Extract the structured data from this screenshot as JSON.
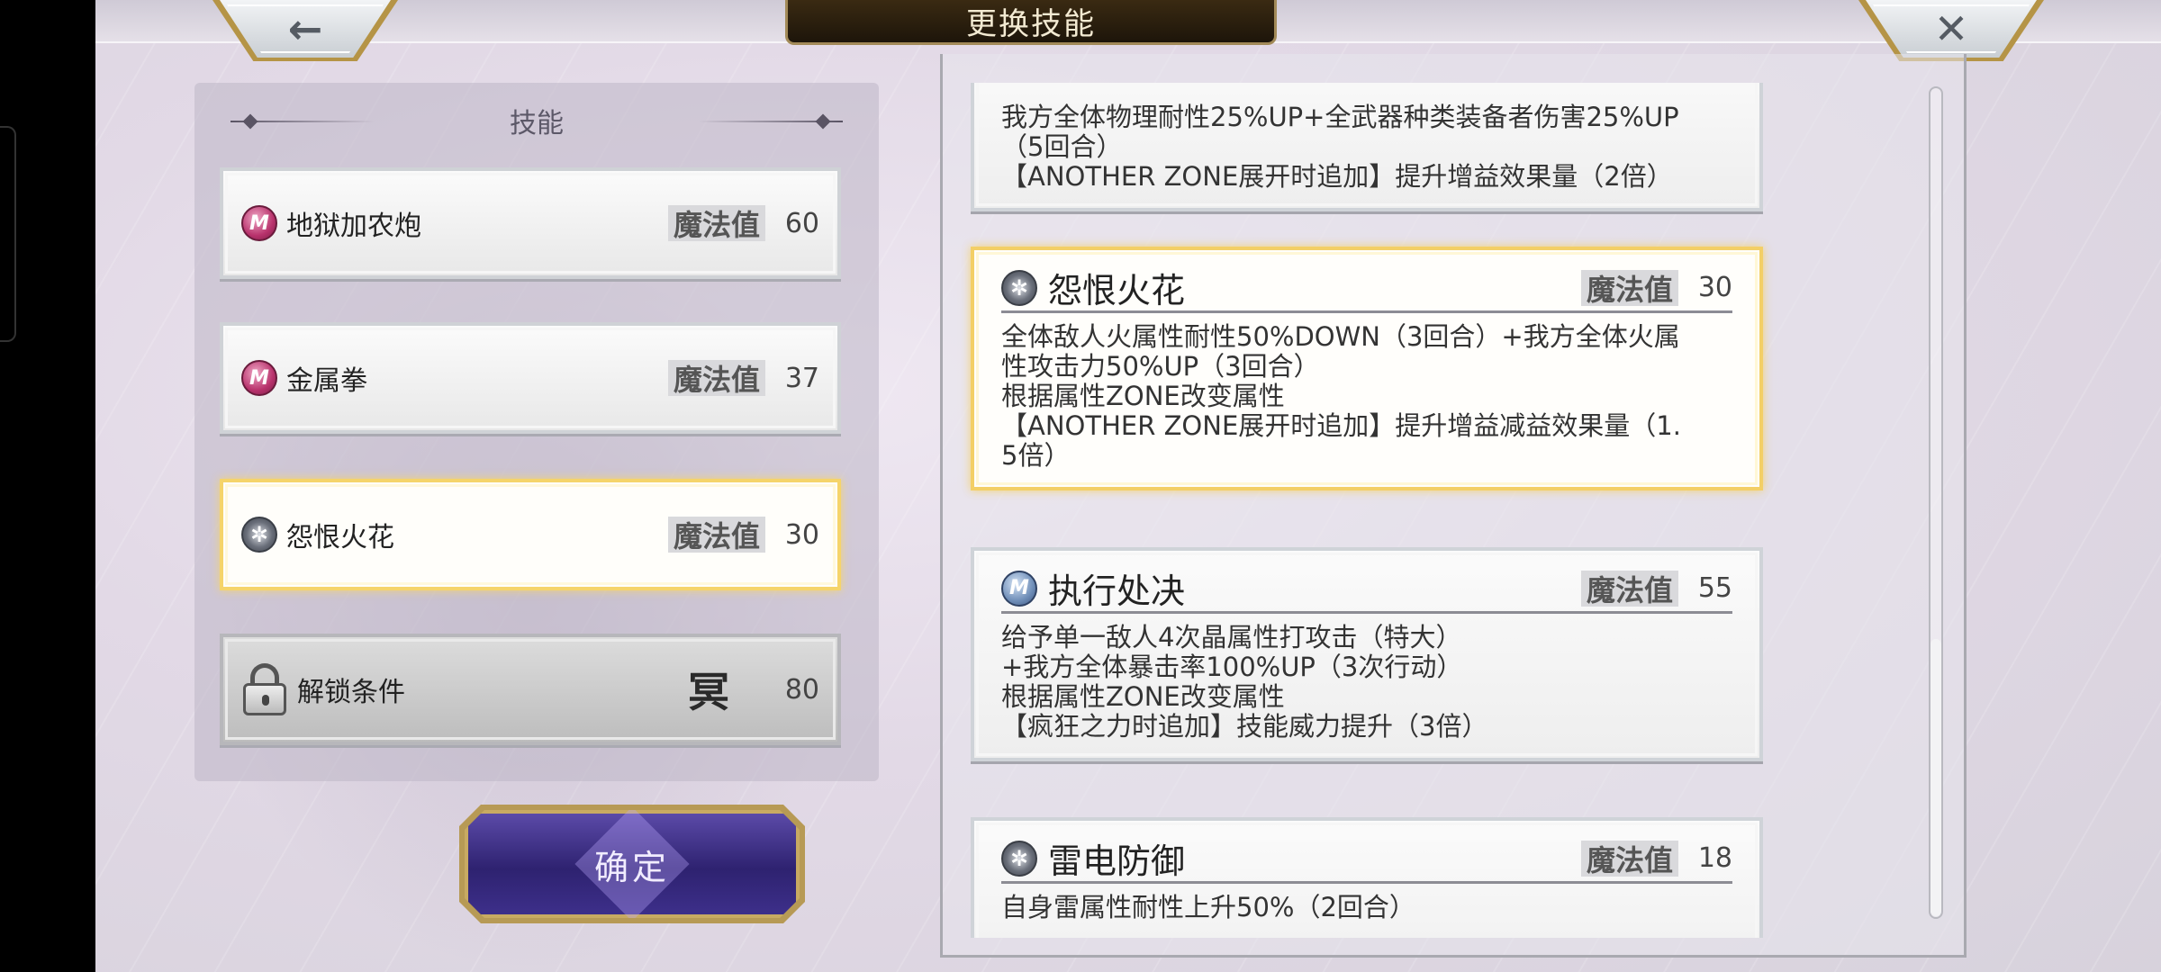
{
  "title": "更换技能",
  "nav": {
    "back_icon": "←",
    "close_icon": "✕"
  },
  "left": {
    "header": "技能",
    "skills": [
      {
        "name": "地狱加农炮",
        "mp_label": "魔法值",
        "mp": "60",
        "icon": "magic-m-icon"
      },
      {
        "name": "金属拳",
        "mp_label": "魔法值",
        "mp": "37",
        "icon": "magic-m-icon"
      },
      {
        "name": "怨恨火花",
        "mp_label": "魔法值",
        "mp": "30",
        "icon": "star-icon",
        "selected": true
      }
    ],
    "locked": {
      "name": "解锁条件",
      "symbol": "冥",
      "value": "80"
    }
  },
  "confirm_label": "确定",
  "details": [
    {
      "desc": [
        "我方全体物理耐性25%UP+全武器种类装备者伤害25%UP",
        "（5回合）",
        "【ANOTHER ZONE展开时追加】提升增益效果量（2倍）"
      ]
    },
    {
      "name": "怨恨火花",
      "mp_label": "魔法值",
      "mp": "30",
      "icon": "star-icon",
      "desc": [
        "全体敌人火属性耐性50%DOWN（3回合）+我方全体火属",
        "性攻击力50%UP（3回合）",
        "根据属性ZONE改变属性",
        "【ANOTHER ZONE展开时追加】提升增益减益效果量（1.",
        "5倍）"
      ]
    },
    {
      "name": "执行处决",
      "mp_label": "魔法值",
      "mp": "55",
      "icon": "magic-m-icon-blue",
      "desc": [
        "给予单一敌人4次晶属性打攻击（特大）",
        "+我方全体暴击率100%UP（3次行动）",
        "根据属性ZONE改变属性",
        "【疯狂之力时追加】技能威力提升（3倍）"
      ]
    },
    {
      "name": "雷电防御",
      "mp_label": "魔法值",
      "mp": "18",
      "icon": "star-icon",
      "desc": [
        "自身雷属性耐性上升50%（2回合）"
      ]
    }
  ]
}
